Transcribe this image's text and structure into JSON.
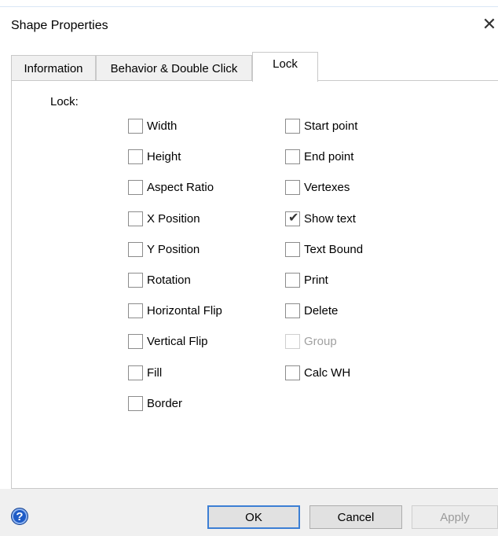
{
  "window": {
    "title": "Shape Properties",
    "close_label": "✕"
  },
  "tabs": [
    {
      "label": "Information",
      "active": false
    },
    {
      "label": "Behavior & Double Click",
      "active": false
    },
    {
      "label": "Lock",
      "active": true
    }
  ],
  "lock": {
    "label": "Lock:",
    "left_options": [
      {
        "label": "Width",
        "checked": false,
        "enabled": true
      },
      {
        "label": "Height",
        "checked": false,
        "enabled": true
      },
      {
        "label": "Aspect Ratio",
        "checked": false,
        "enabled": true
      },
      {
        "label": "X Position",
        "checked": false,
        "enabled": true
      },
      {
        "label": "Y Position",
        "checked": false,
        "enabled": true
      },
      {
        "label": "Rotation",
        "checked": false,
        "enabled": true
      },
      {
        "label": "Horizontal Flip",
        "checked": false,
        "enabled": true
      },
      {
        "label": "Vertical Flip",
        "checked": false,
        "enabled": true
      },
      {
        "label": "Fill",
        "checked": false,
        "enabled": true
      },
      {
        "label": "Border",
        "checked": false,
        "enabled": true
      }
    ],
    "right_options": [
      {
        "label": "Start point",
        "checked": false,
        "enabled": true
      },
      {
        "label": "End point",
        "checked": false,
        "enabled": true
      },
      {
        "label": "Vertexes",
        "checked": false,
        "enabled": true
      },
      {
        "label": "Show text",
        "checked": true,
        "enabled": true
      },
      {
        "label": "Text Bound",
        "checked": false,
        "enabled": true
      },
      {
        "label": "Print",
        "checked": false,
        "enabled": true
      },
      {
        "label": "Delete",
        "checked": false,
        "enabled": true
      },
      {
        "label": "Group",
        "checked": false,
        "enabled": false
      },
      {
        "label": "Calc WH",
        "checked": false,
        "enabled": true
      }
    ]
  },
  "buttons": {
    "help_label": "?",
    "ok_label": "OK",
    "cancel_label": "Cancel",
    "apply_label": "Apply"
  },
  "icons": {
    "help": "help-icon",
    "close": "close-icon",
    "check": "checkmark-icon"
  },
  "colors": {
    "help_blue": "#1e5bc6",
    "default_button_border": "#3c7fd4",
    "footer_bg": "#f0f0f0"
  }
}
